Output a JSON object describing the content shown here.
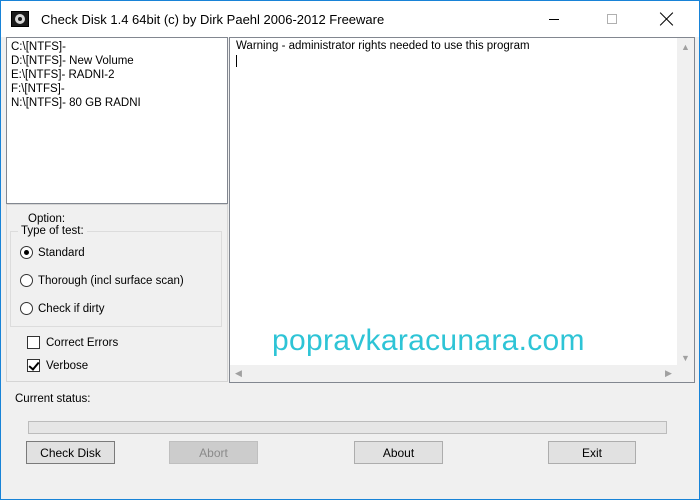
{
  "window": {
    "title": "Check Disk 1.4 64bit (c) by Dirk Paehl  2006-2012 Freeware",
    "icon": "checkdisk-app-icon",
    "controls": {
      "minimize": "minimize-icon",
      "maximize": "maximize-icon",
      "close": "close-icon"
    }
  },
  "drives": [
    {
      "label": "C:\\[NTFS]-"
    },
    {
      "label": "D:\\[NTFS]- New Volume"
    },
    {
      "label": "E:\\[NTFS]- RADNI-2"
    },
    {
      "label": "F:\\[NTFS]-"
    },
    {
      "label": "N:\\[NTFS]- 80 GB RADNI"
    }
  ],
  "options": {
    "label": "Option:",
    "test_type": {
      "label": "Type of test:",
      "choices": [
        {
          "label": "Standard",
          "selected": true
        },
        {
          "label": "Thorough (incl surface scan)",
          "selected": false
        },
        {
          "label": "Check if dirty",
          "selected": false
        }
      ]
    },
    "correct_errors": {
      "label": "Correct Errors",
      "checked": false
    },
    "verbose": {
      "label": "Verbose",
      "checked": true
    }
  },
  "log": {
    "text": "Warning - administrator rights needed to use this program"
  },
  "watermark": "popravkaracunara.com",
  "status": {
    "label": "Current status:",
    "progress": 0
  },
  "buttons": {
    "check_disk": "Check Disk",
    "abort": "Abort",
    "about": "About",
    "exit": "Exit"
  },
  "colors": {
    "watermark": "#2ec4d6",
    "window_border": "#1883d7"
  }
}
